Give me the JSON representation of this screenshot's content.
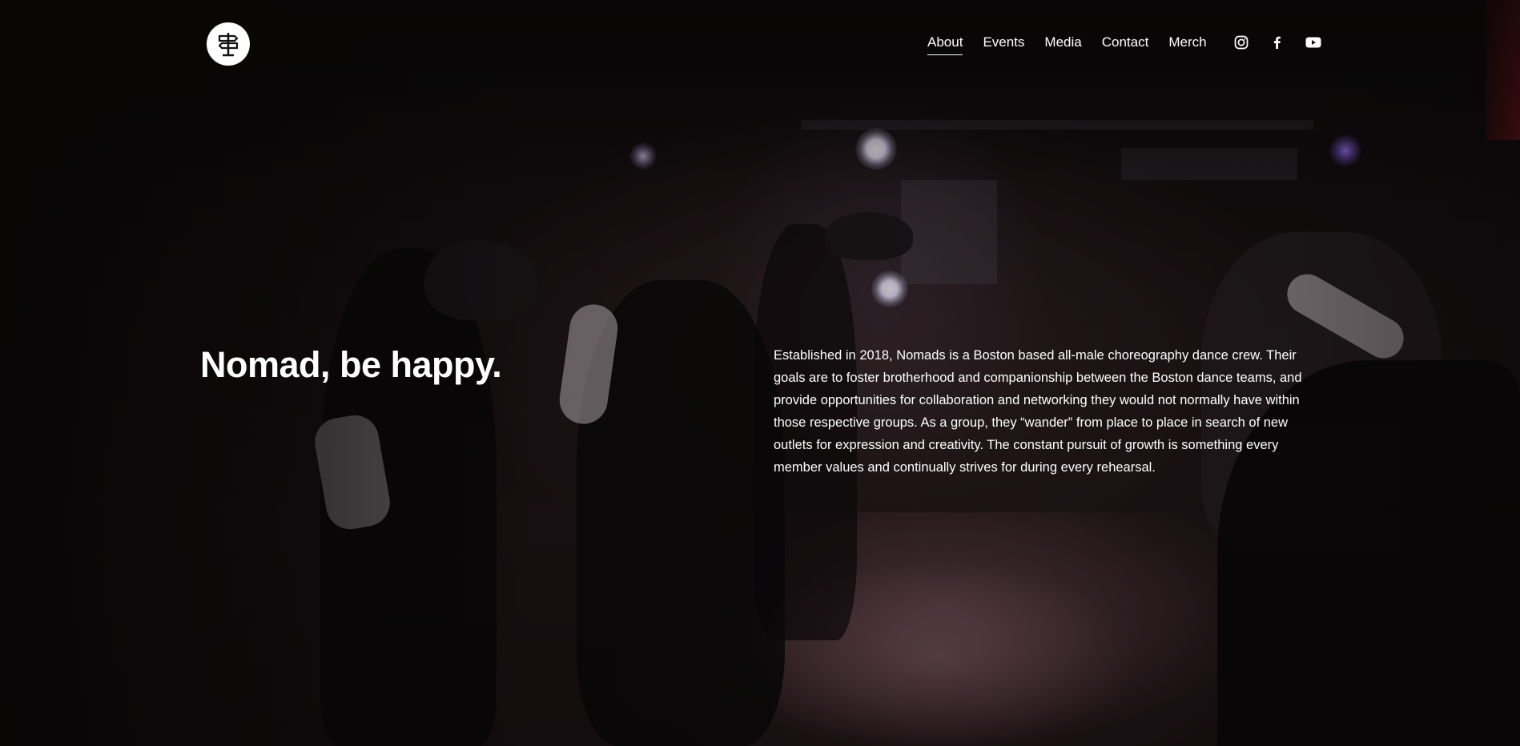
{
  "header": {
    "logo_icon": "signpost-logo-icon",
    "nav": [
      {
        "label": "About",
        "active": true
      },
      {
        "label": "Events",
        "active": false
      },
      {
        "label": "Media",
        "active": false
      },
      {
        "label": "Contact",
        "active": false
      },
      {
        "label": "Merch",
        "active": false
      }
    ],
    "social": [
      {
        "icon": "instagram-icon"
      },
      {
        "icon": "facebook-icon"
      },
      {
        "icon": "youtube-icon"
      }
    ]
  },
  "hero": {
    "headline": "Nomad, be happy.",
    "description": "Established in 2018, Nomads is a Boston based all-male choreography dance crew. Their goals are to foster brotherhood and companionship between the Boston dance teams, and provide opportunities for collaboration and networking they would not normally have within those respective groups. As a group, they “wander” from place to place in search of new outlets for expression and creativity. The constant pursuit of growth is something every member values and continually strives for during every rehearsal."
  },
  "colors": {
    "text": "#ffffff",
    "background": "#120d0e"
  }
}
